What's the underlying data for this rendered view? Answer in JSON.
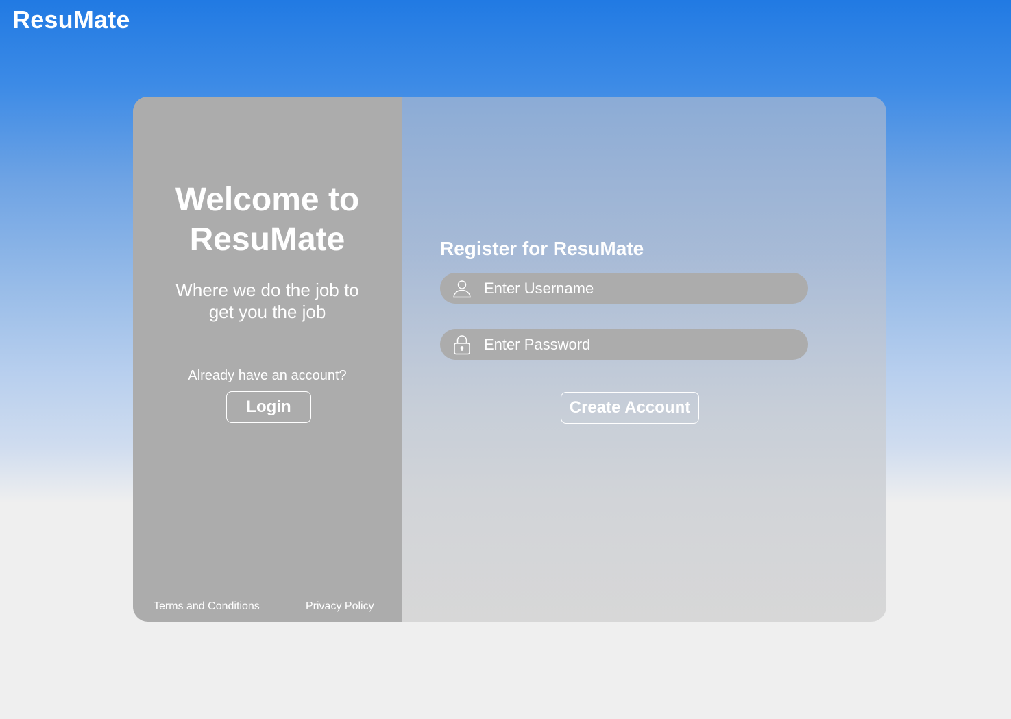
{
  "header": {
    "brand": "ResuMate"
  },
  "welcome": {
    "title": "Welcome to\nResuMate",
    "tagline": "Where we do the job to get you the job",
    "already_account": "Already have an account?",
    "login_label": "Login",
    "terms_label": "Terms and Conditions",
    "privacy_label": "Privacy Policy"
  },
  "register": {
    "title": "Register for ResuMate",
    "username": {
      "icon": "user-icon",
      "placeholder": "Enter Username",
      "value": ""
    },
    "password": {
      "icon": "lock-icon",
      "placeholder": "Enter Password",
      "value": ""
    },
    "create_label": "Create Account"
  },
  "colors": {
    "header_blue": "#217ae3",
    "panel_gray": "#acacac",
    "field_gray": "#acacac",
    "background": "#efefef",
    "text": "#ffffff"
  }
}
